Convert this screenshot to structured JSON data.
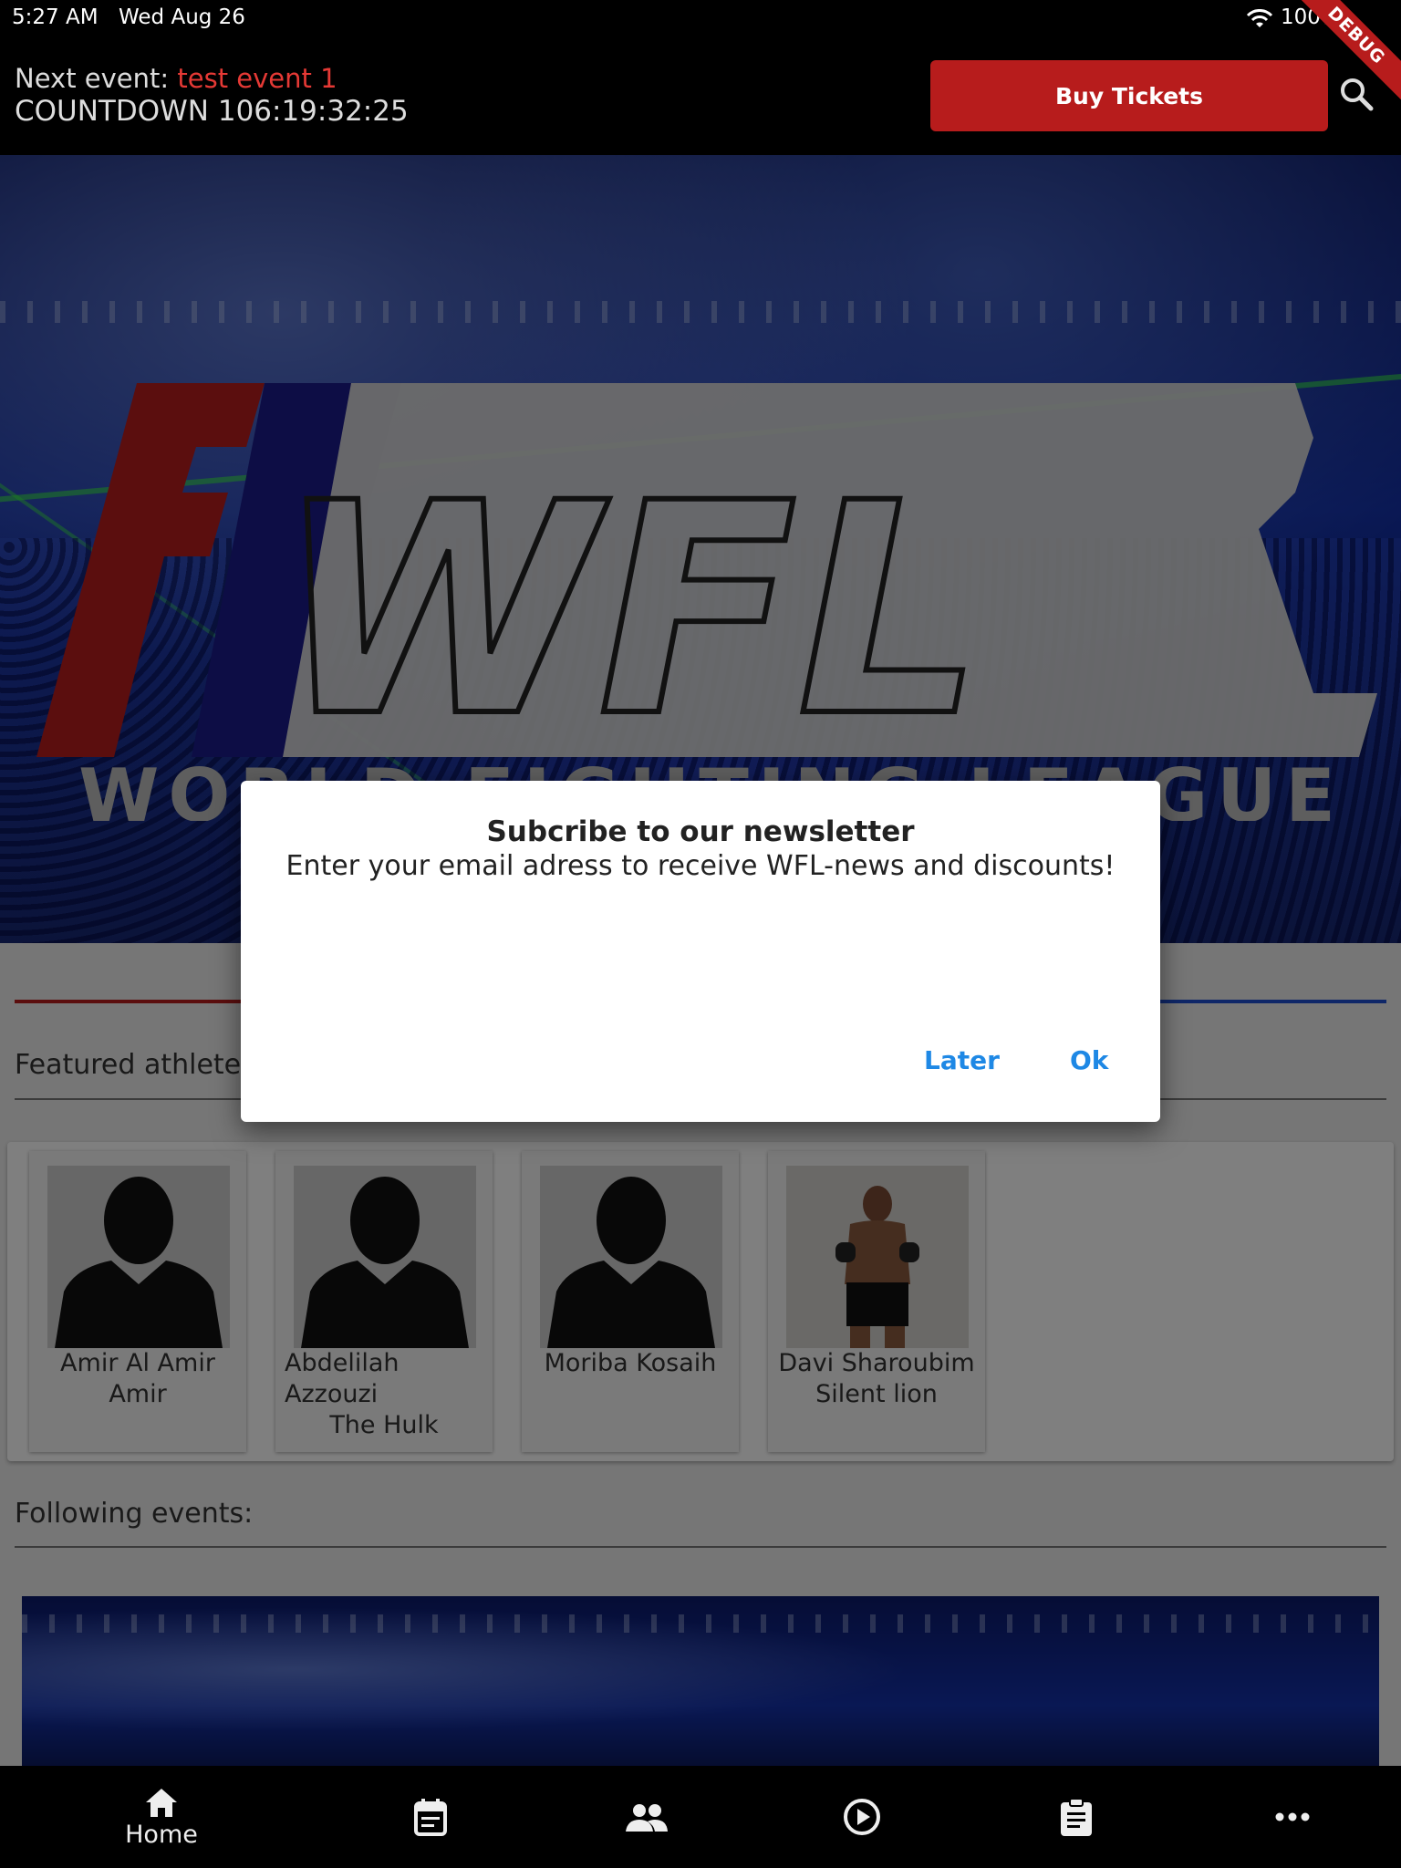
{
  "status_bar": {
    "time": "5:27 AM",
    "date": "Wed Aug 26",
    "battery": "100%",
    "debug_banner": "DEBUG"
  },
  "header": {
    "next_event_label": "Next event:",
    "next_event_name": "test event 1",
    "countdown_label": "COUNTDOWN",
    "countdown_value": "106:19:32:25",
    "buy_tickets_label": "Buy Tickets",
    "search_icon": "search-icon"
  },
  "hero": {
    "logo_text": "WFL",
    "logo_subtitle": "WORLD FIGHTING LEAGUE",
    "colors": {
      "red": "#b71c1c",
      "blue": "#1a1a8a"
    }
  },
  "featured": {
    "title": "Featured athletes:",
    "athletes": [
      {
        "name": "Amir Al Amir",
        "nickname": "Amir"
      },
      {
        "name": "Abdelilah Azzouzi",
        "nickname": "The Hulk"
      },
      {
        "name": "Moriba Kosaih",
        "nickname": ""
      },
      {
        "name": "Davi Sharoubim",
        "nickname": "Silent lion"
      }
    ]
  },
  "following": {
    "title": "Following events:"
  },
  "dialog": {
    "title": "Subcribe to our newsletter",
    "body": "Enter your email adress to receive WFL-news and discounts!",
    "later_label": "Later",
    "ok_label": "Ok"
  },
  "bottom_nav": {
    "items": [
      {
        "icon": "home-icon",
        "label": "Home"
      },
      {
        "icon": "calendar-icon",
        "label": ""
      },
      {
        "icon": "people-icon",
        "label": ""
      },
      {
        "icon": "play-circle-icon",
        "label": ""
      },
      {
        "icon": "clipboard-icon",
        "label": ""
      },
      {
        "icon": "more-icon",
        "label": ""
      }
    ]
  },
  "accent_colors": {
    "primary_red": "#b71c1c",
    "link_blue": "#1e88e5"
  }
}
